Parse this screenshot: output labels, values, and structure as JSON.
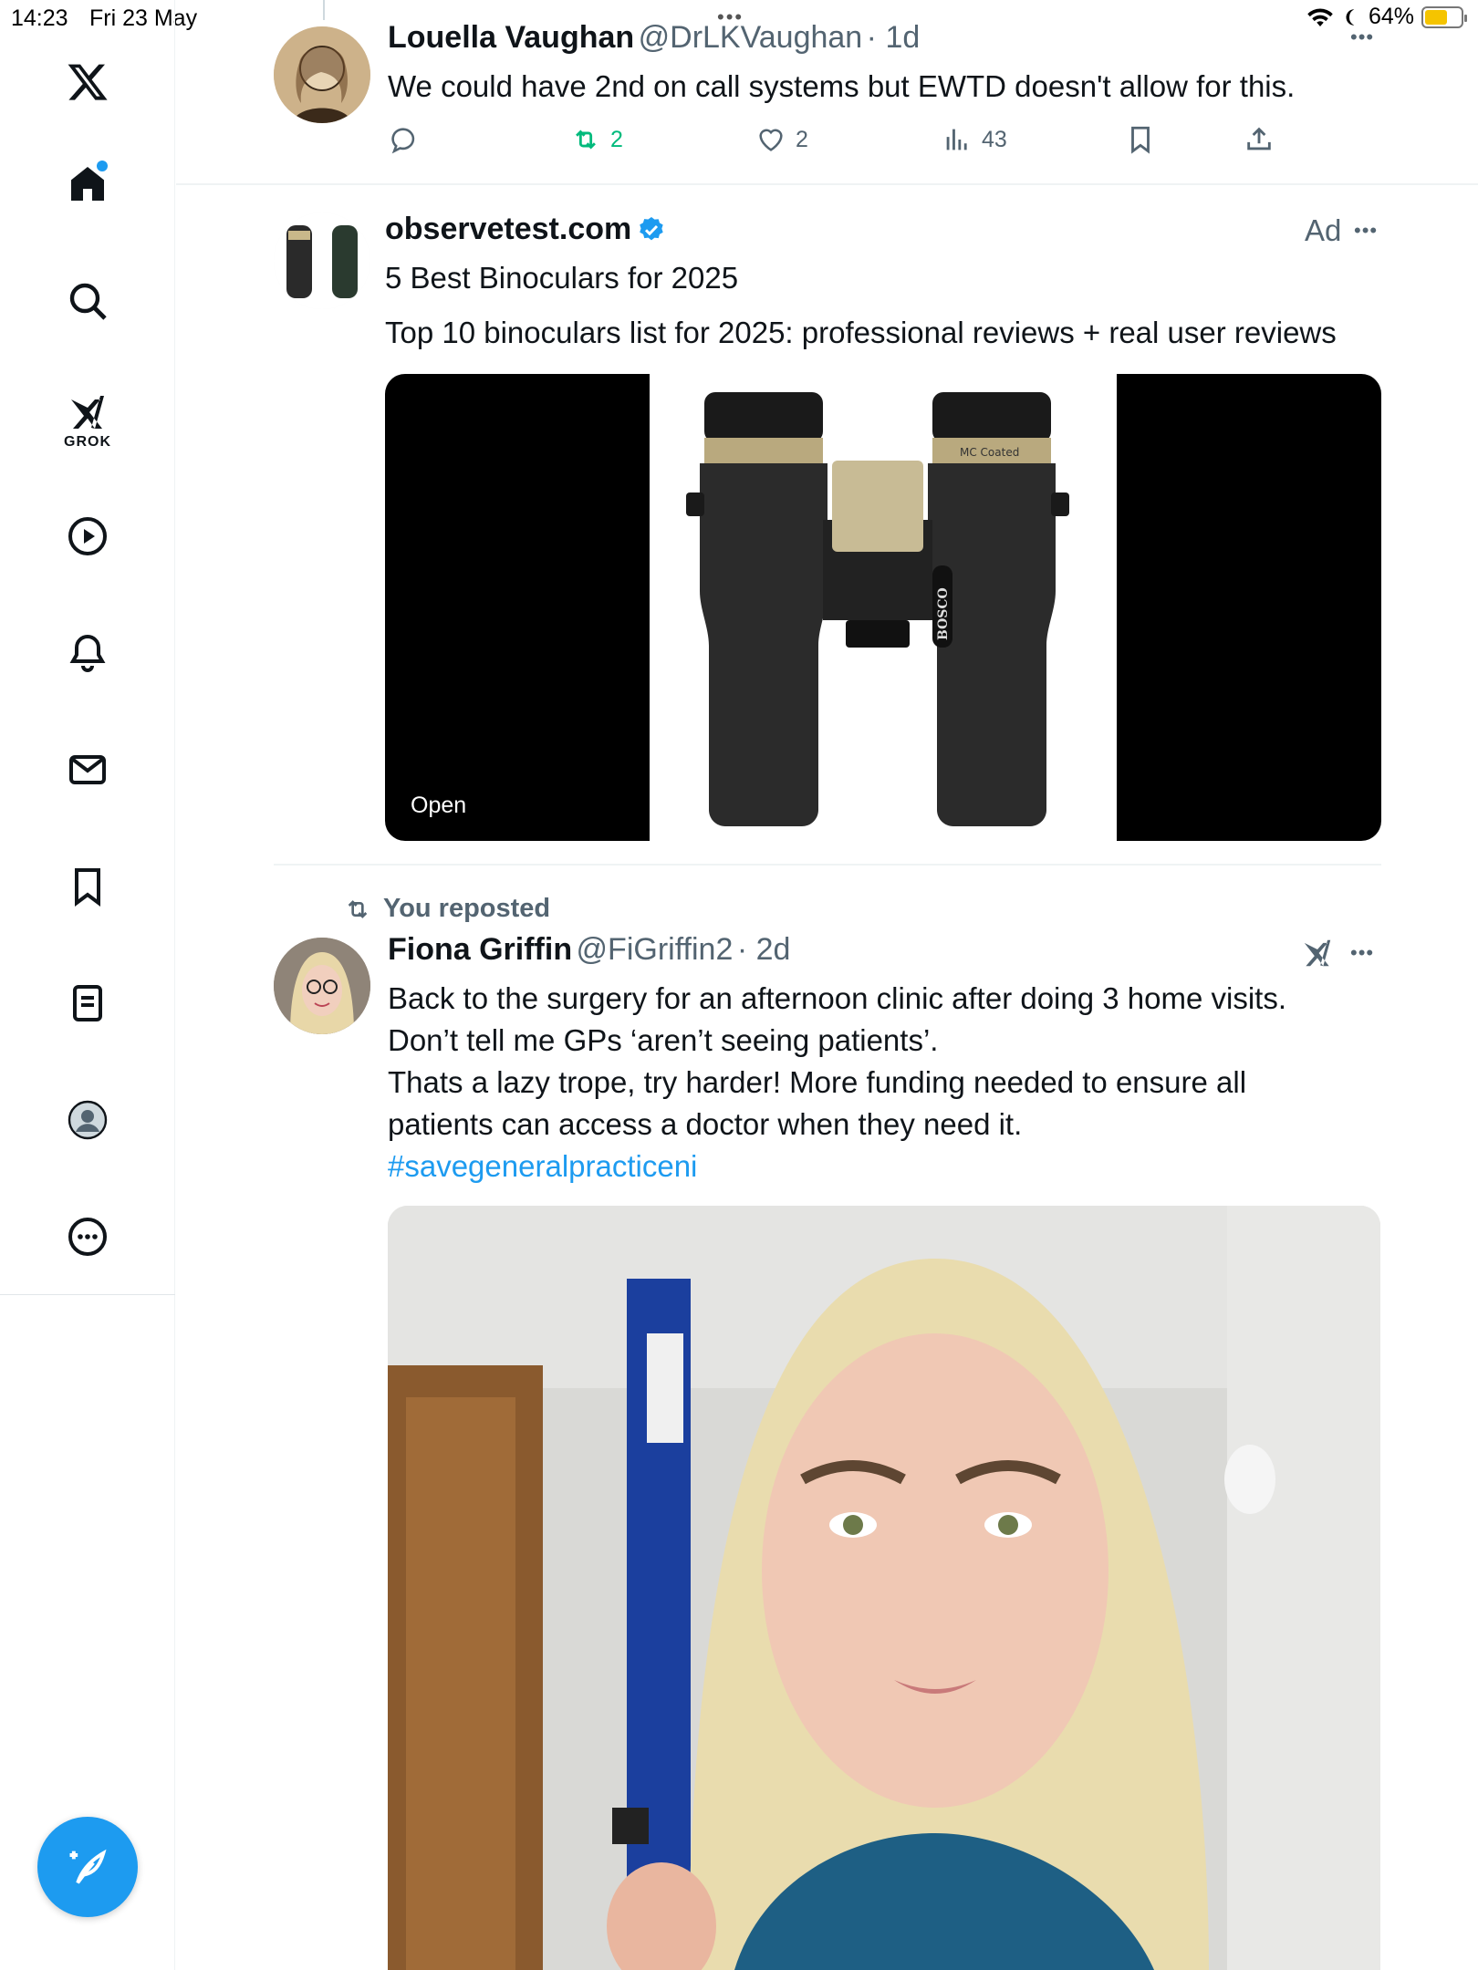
{
  "status_bar": {
    "time": "14:23",
    "date": "Fri 23 May",
    "battery_percent": "64%",
    "battery_level": 0.64,
    "battery_color": "#f5c400"
  },
  "sidebar": {
    "items": [
      {
        "name": "x-logo-icon"
      },
      {
        "name": "home-icon"
      },
      {
        "name": "search-icon"
      },
      {
        "name": "grok-icon",
        "label": "GROK"
      },
      {
        "name": "video-play-icon"
      },
      {
        "name": "notifications-bell-icon"
      },
      {
        "name": "messages-envelope-icon"
      },
      {
        "name": "bookmarks-icon"
      },
      {
        "name": "lists-icon"
      },
      {
        "name": "profile-avatar-icon"
      },
      {
        "name": "more-circle-icon"
      }
    ],
    "compose_button": "compose-feather-icon"
  },
  "accent_color": "#1d9bf0",
  "repost_color": "#00ba7c",
  "tweets": [
    {
      "name": "Louella Vaughan",
      "handle": "@DrLKVaughan",
      "time": "· 1d",
      "text": "We could have 2nd on call systems but EWTD doesn't allow for this.",
      "replies": "",
      "reposts": "2",
      "likes": "2",
      "views": "43"
    },
    {
      "name": "observetest.com",
      "verified": true,
      "ad_label": "Ad",
      "headline": "5 Best Binoculars for 2025",
      "text": "Top 10 binoculars list for 2025: professional reviews + real user reviews",
      "image_brand": "BOSCO",
      "image_badge": "MC Coated",
      "open_label": "Open"
    },
    {
      "repost_label": "You reposted",
      "name": "Fiona Griffin",
      "handle": "@FiGriffin2",
      "time": "· 2d",
      "text_lines": [
        "Back to the surgery for an afternoon clinic after doing 3 home visits.",
        "Don’t tell me GPs ‘aren’t seeing patients’.",
        "Thats a lazy trope, try harder! More funding needed to ensure all",
        "patients can access a doctor when they need it."
      ],
      "hashtag": "#savegeneralpracticeni"
    }
  ]
}
